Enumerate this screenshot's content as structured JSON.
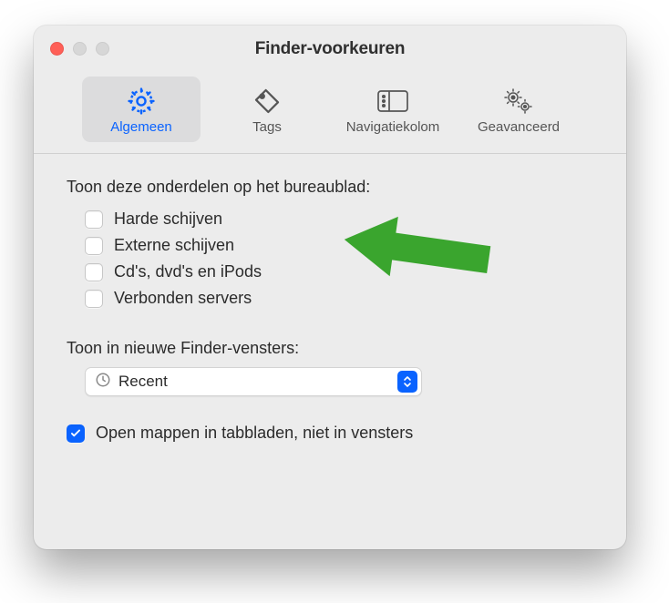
{
  "window": {
    "title": "Finder-voorkeuren"
  },
  "tabs": {
    "general": "Algemeen",
    "tags": "Tags",
    "sidebar": "Navigatiekolom",
    "advanced": "Geavanceerd"
  },
  "desktop_section": {
    "label": "Toon deze onderdelen op het bureaublad:",
    "items": [
      {
        "label": "Harde schijven",
        "checked": false
      },
      {
        "label": "Externe schijven",
        "checked": false
      },
      {
        "label": "Cd's, dvd's en iPods",
        "checked": false
      },
      {
        "label": "Verbonden servers",
        "checked": false
      }
    ]
  },
  "new_windows_section": {
    "label": "Toon in nieuwe Finder-vensters:",
    "selected": "Recent"
  },
  "footer_option": {
    "label": "Open mappen in tabbladen, niet in vensters",
    "checked": true
  }
}
